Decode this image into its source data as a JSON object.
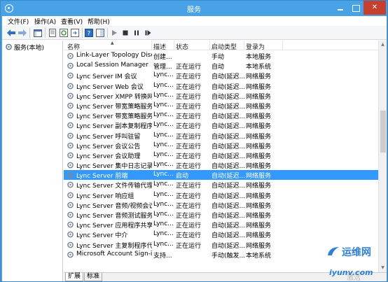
{
  "window": {
    "title": "服务"
  },
  "menu": [
    "文件(F)",
    "操作(A)",
    "查看(V)",
    "帮助(H)"
  ],
  "tree": {
    "root_label": "服务(本地)"
  },
  "columns": {
    "name": "名称",
    "desc": "描述",
    "status": "状态",
    "startup": "启动类型",
    "logon": "登录为"
  },
  "services": [
    {
      "name": "Link-Layer Topology Disc...",
      "desc": "创建...",
      "status": "",
      "startup": "手动",
      "logon": "本地服务"
    },
    {
      "name": "Local Session Manager",
      "desc": "管理...",
      "status": "正在运行",
      "startup": "自动",
      "logon": "本地系统"
    },
    {
      "name": "Lync Server IM 会议",
      "desc": "Lync...",
      "status": "正在运行",
      "startup": "自动(延迟...",
      "logon": "网络服务"
    },
    {
      "name": "Lync Server Web 会议",
      "desc": "Lync...",
      "status": "正在运行",
      "startup": "自动(延迟...",
      "logon": "网络服务"
    },
    {
      "name": "Lync Server XMPP 转换网关",
      "desc": "Lync...",
      "status": "正在运行",
      "startup": "自动(延迟...",
      "logon": "网络服务"
    },
    {
      "name": "Lync Server 带宽策略服务(...",
      "desc": "Lync...",
      "status": "正在运行",
      "startup": "自动(延迟...",
      "logon": "网络服务"
    },
    {
      "name": "Lync Server 带宽策略服务(...",
      "desc": "Lync...",
      "status": "正在运行",
      "startup": "自动(延迟...",
      "logon": "网络服务"
    },
    {
      "name": "Lync Server 副本复制程序...",
      "desc": "Lync...",
      "status": "正在运行",
      "startup": "自动(延迟...",
      "logon": "网络服务"
    },
    {
      "name": "Lync Server 呼叫驻留",
      "desc": "Lync...",
      "status": "正在运行",
      "startup": "自动(延迟...",
      "logon": "网络服务"
    },
    {
      "name": "Lync Server 会议公告",
      "desc": "Lync...",
      "status": "正在运行",
      "startup": "自动(延迟...",
      "logon": "网络服务"
    },
    {
      "name": "Lync Server 会议助理",
      "desc": "Lync...",
      "status": "正在运行",
      "startup": "自动(延迟...",
      "logon": "网络服务"
    },
    {
      "name": "Lync Server 集中日志记录...",
      "desc": "Lync...",
      "status": "正在运行",
      "startup": "自动(延迟...",
      "logon": "网络服务"
    },
    {
      "name": "Lync Server 前端",
      "desc": "Lync...",
      "status": "启动",
      "startup": "自动(延迟...",
      "logon": "网络服务"
    },
    {
      "name": "Lync Server 文件传输代理",
      "desc": "Lync...",
      "status": "正在运行",
      "startup": "自动(延迟...",
      "logon": "网络服务"
    },
    {
      "name": "Lync Server 响应组",
      "desc": "Lync...",
      "status": "正在运行",
      "startup": "自动(延迟...",
      "logon": "网络服务"
    },
    {
      "name": "Lync Server 音频/视频会议",
      "desc": "Lync...",
      "status": "正在运行",
      "startup": "自动(延迟...",
      "logon": "网络服务"
    },
    {
      "name": "Lync Server 音频测试服务",
      "desc": "Lync...",
      "status": "正在运行",
      "startup": "自动(延迟...",
      "logon": "网络服务"
    },
    {
      "name": "Lync Server 应用程序共享",
      "desc": "Lync...",
      "status": "正在运行",
      "startup": "自动(延迟...",
      "logon": "网络服务"
    },
    {
      "name": "Lync Server 中介",
      "desc": "Lync...",
      "status": "正在运行",
      "startup": "自动(延迟...",
      "logon": "网络服务"
    },
    {
      "name": "Lync Server 主复制程序代理",
      "desc": "Lync...",
      "status": "正在运行",
      "startup": "自动(延迟...",
      "logon": "网络服务"
    },
    {
      "name": "Microsoft Account Sign-i...",
      "desc": "支持...",
      "status": "",
      "startup": "手动(触发...",
      "logon": "本地系统"
    }
  ],
  "selected_index": 12,
  "tabs": {
    "extended": "扩展",
    "standard": "标准"
  },
  "watermark": {
    "brand": "运维网",
    "url": "iyunv.com",
    "win_text": "激活 Windows"
  },
  "colors": {
    "titlebar": "#4aa2e6",
    "selection": "#3399ff",
    "close": "#c7402f"
  }
}
